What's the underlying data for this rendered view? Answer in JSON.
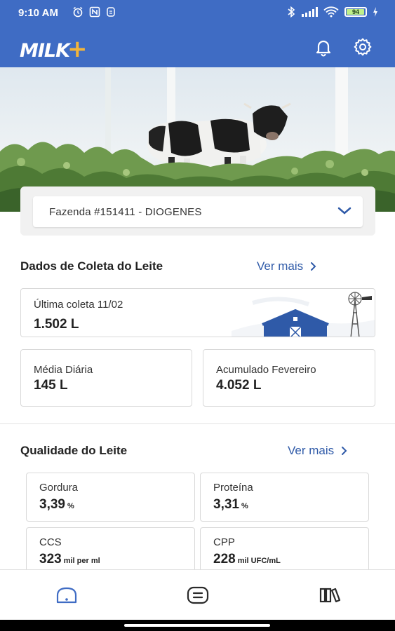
{
  "status_bar": {
    "time": "9:10 AM",
    "left_icons": [
      "alarm-icon",
      "nfc-icon",
      "sync-icon"
    ],
    "right_icons": [
      "bluetooth-icon",
      "signal-icon",
      "wifi-icon"
    ],
    "battery": "94"
  },
  "app": {
    "logo_text": "MILK",
    "logo_plus": "+",
    "brand_color": "#3f6cc4",
    "accent_color": "#f3b53a"
  },
  "farm": {
    "selected": "Fazenda #151411 - DIOGENES"
  },
  "collection": {
    "title": "Dados de Coleta do Leite",
    "ver_mais": "Ver mais",
    "last_label": "Última coleta 11/02",
    "last_value": "1.502 L",
    "daily_label": "Média Diária",
    "daily_value": "145 L",
    "accum_label": "Acumulado Fevereiro",
    "accum_value": "4.052 L"
  },
  "quality": {
    "title": "Qualidade do Leite",
    "ver_mais": "Ver mais",
    "items": [
      {
        "label": "Gordura",
        "value": "3,39",
        "unit": "%"
      },
      {
        "label": "Proteína",
        "value": "3,31",
        "unit": "%"
      },
      {
        "label": "CCS",
        "value": "323",
        "unit": "mil per ml"
      },
      {
        "label": "CPP",
        "value": "228",
        "unit": "mil UFC/mL"
      }
    ]
  },
  "bottom_nav": [
    "home-icon",
    "list-icon",
    "library-icon"
  ]
}
